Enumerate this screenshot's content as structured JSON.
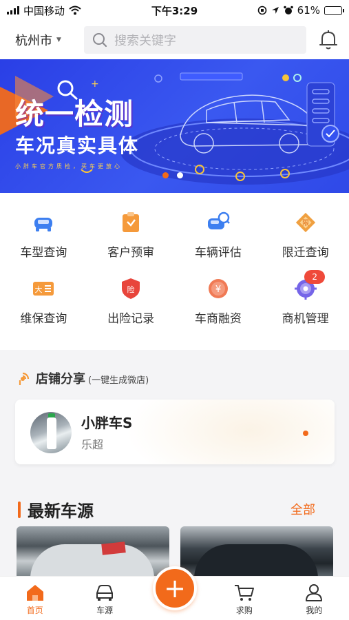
{
  "status_bar": {
    "carrier": "中国移动",
    "time": "下午3:29",
    "battery": "61%",
    "battery_level": 0.61
  },
  "header": {
    "city": "杭州市",
    "search_placeholder": "搜索关键字"
  },
  "banner": {
    "title": "统一检测",
    "subtitle": "车况真实具体",
    "tagline": "小胖车官方质检，买车更放心",
    "page_count": 2,
    "active_page": 1
  },
  "functions": [
    {
      "label": "车型查询",
      "icon": "car-front-icon",
      "color": "#3d7ff0"
    },
    {
      "label": "客户预审",
      "icon": "clipboard-icon",
      "color": "#f59a3b"
    },
    {
      "label": "车辆评估",
      "icon": "car-search-icon",
      "color": "#3d7ff0"
    },
    {
      "label": "限迁查询",
      "icon": "diamond-limit-icon",
      "color": "#f0a040"
    },
    {
      "label": "维保查询",
      "icon": "maintenance-ticket-icon",
      "color": "#f59a3b"
    },
    {
      "label": "出险记录",
      "icon": "insurance-shield-icon",
      "color": "#e8453c"
    },
    {
      "label": "车商融资",
      "icon": "yuan-coin-icon",
      "color": "#f07a55"
    },
    {
      "label": "商机管理",
      "icon": "target-icon",
      "color": "#7565e8",
      "badge": "2"
    }
  ],
  "share": {
    "title": "店铺分享",
    "subtitle": "(一键生成微店)",
    "shop_name": "小胖车S",
    "owner": "乐超"
  },
  "latest": {
    "title": "最新车源",
    "all_label": "全部"
  },
  "tabs": [
    {
      "label": "首页",
      "icon": "home-icon",
      "active": true
    },
    {
      "label": "车源",
      "icon": "car-outline-icon",
      "active": false
    },
    {
      "label": "求购",
      "icon": "cart-icon",
      "active": false
    },
    {
      "label": "我的",
      "icon": "person-icon",
      "active": false
    }
  ],
  "fab_label": "+",
  "colors": {
    "accent": "#f26a1b",
    "banner_blue": "#3a58f0"
  }
}
